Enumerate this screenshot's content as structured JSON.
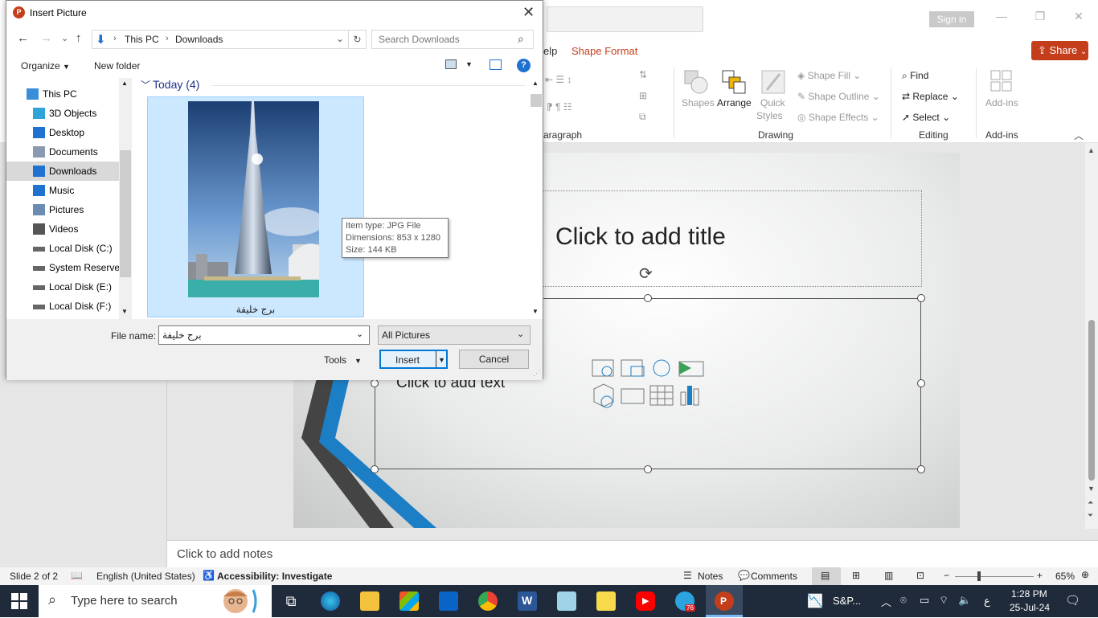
{
  "ppt": {
    "sign_in": "Sign in",
    "share": "Share",
    "tabs": [
      "elp",
      "Shape Format"
    ],
    "ribbon": {
      "paragraph_label": "aragraph",
      "drawing_label": "Drawing",
      "editing_label": "Editing",
      "addins_label": "Add-ins",
      "shapes": "Shapes",
      "arrange": "Arrange",
      "quick_styles_1": "Quick",
      "quick_styles_2": "Styles",
      "shape_fill": "Shape Fill",
      "shape_outline": "Shape Outline",
      "shape_effects": "Shape Effects",
      "find": "Find",
      "replace": "Replace",
      "select": "Select",
      "addins": "Add-ins"
    },
    "slide": {
      "title_placeholder": "Click to add title",
      "body_placeholder": "Click to add text"
    },
    "notes_placeholder": "Click to add notes",
    "status": {
      "slide": "Slide 2 of 2",
      "language": "English (United States)",
      "accessibility": "Accessibility: Investigate",
      "notes": "Notes",
      "comments": "Comments",
      "zoom": "65%"
    }
  },
  "taskbar": {
    "search_placeholder": "Type here to search",
    "stock": "S&P...",
    "lang": "ع",
    "time": "1:28 PM",
    "date": "25-Jul-24",
    "telegram_badge": "76"
  },
  "dialog": {
    "title": "Insert Picture",
    "breadcrumb": [
      "This PC",
      "Downloads"
    ],
    "search_placeholder": "Search Downloads",
    "organize": "Organize",
    "new_folder": "New folder",
    "group_header": "Today (4)",
    "nav_items": [
      {
        "label": "This PC",
        "icon": "pc-icon"
      },
      {
        "label": "3D Objects",
        "icon": "cube-icon"
      },
      {
        "label": "Desktop",
        "icon": "desktop-icon"
      },
      {
        "label": "Documents",
        "icon": "document-icon"
      },
      {
        "label": "Downloads",
        "icon": "download-icon"
      },
      {
        "label": "Music",
        "icon": "music-icon"
      },
      {
        "label": "Pictures",
        "icon": "pictures-icon"
      },
      {
        "label": "Videos",
        "icon": "videos-icon"
      },
      {
        "label": "Local Disk (C:)",
        "icon": "disk-icon"
      },
      {
        "label": "System Reserved",
        "icon": "disk-icon"
      },
      {
        "label": "Local Disk (E:)",
        "icon": "disk-icon"
      },
      {
        "label": "Local Disk (F:)",
        "icon": "disk-icon"
      }
    ],
    "file_name_caption": "برج خليفة",
    "tooltip": {
      "type": "Item type: JPG File",
      "dimensions": "Dimensions: 853 x 1280",
      "size": "Size: 144 KB"
    },
    "file_name_label": "File name:",
    "file_name_value": "برج خليفة",
    "filter": "All Pictures",
    "tools": "Tools",
    "insert": "Insert",
    "cancel": "Cancel"
  }
}
